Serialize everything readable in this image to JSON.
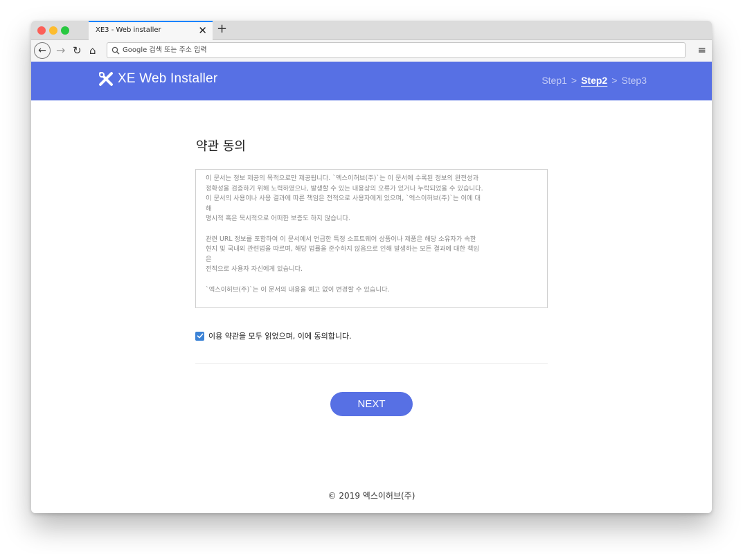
{
  "browser": {
    "tab_title": "XE3 - Web installer",
    "tab_close": "✕",
    "new_tab": "+",
    "nav": {
      "back": "←",
      "forward": "→",
      "reload": "↻",
      "home": "⌂",
      "menu": "≡"
    },
    "url_placeholder": "Google 검색 또는 주소 입력",
    "search_icon": "⚲"
  },
  "header": {
    "brand": "XE  Web Installer",
    "steps": [
      {
        "label": "Step1",
        "active": false
      },
      {
        "label": "Step2",
        "active": true
      },
      {
        "label": "Step3",
        "active": false
      }
    ],
    "separator": ">"
  },
  "main": {
    "title": "약관 동의",
    "terms_paragraphs": [
      "이 문서는 정보 제공의 목적으로만 제공됩니다. `엑스이허브(주)`는 이 문서에 수록된 정보의 완전성과\n정확성을 검증하기 위해 노력하였으나, 발생할 수 있는 내용상의 오류가 있거나 누락되었을 수 있습니다.\n이 문서의 사용이나 사용 결과에 따른 책임은 전적으로 사용자에게 있으며, `엑스이허브(주)`는 이에 대\n해\n명시적 혹은 묵시적으로 어떠한 보증도 하지 않습니다.",
      "관련 URL 정보를 포함하여 이 문서에서 언급한 특정 소프트웨어 상품이나 제품은 해당 소유자가 속한\n현지 및 국내외 관련법을 따르며, 해당 법률을 준수하지 않음으로 인해 발생하는 모든 결과에 대한 책임\n은\n전적으로 사용자 자신에게 있습니다.",
      "`엑스이허브(주)`는 이 문서의 내용을 예고 없이 변경할 수 있습니다."
    ],
    "agree_label": "이용 약관을 모두 읽었으며, 이에 동의합니다.",
    "agree_checked": true,
    "next_label": "NEXT"
  },
  "footer": {
    "copyright": "© 2019 엑스이허브(주)"
  },
  "colors": {
    "accent": "#5770e4",
    "checkbox": "#3b82d6"
  }
}
